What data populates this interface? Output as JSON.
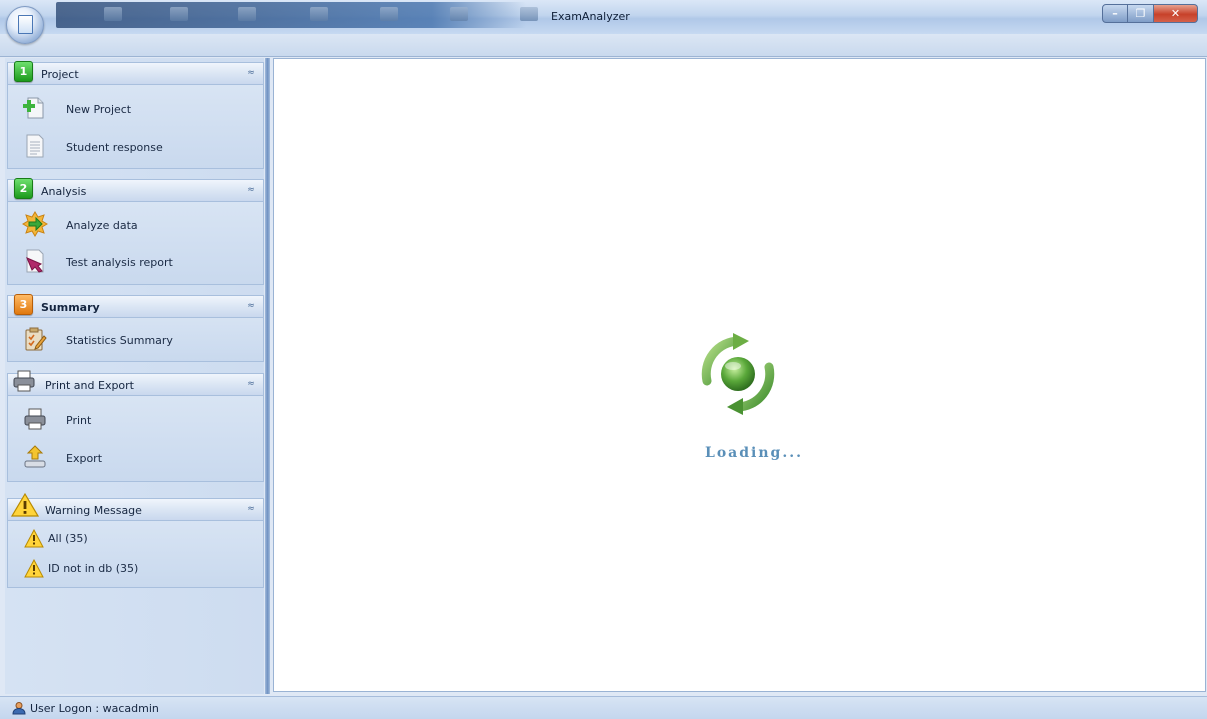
{
  "window": {
    "title": "ExamAnalyzer",
    "controls": {
      "minimize": "–",
      "maximize": "❐",
      "close": "✕"
    }
  },
  "nav": {
    "groups": [
      {
        "number": "1",
        "badge_color": "#2aa52a",
        "title": "Project",
        "items": [
          {
            "label": "New Project",
            "icon": "new-project-icon"
          },
          {
            "label": "Student response",
            "icon": "document-icon"
          }
        ]
      },
      {
        "number": "2",
        "badge_color": "#2aa52a",
        "title": "Analysis",
        "items": [
          {
            "label": "Analyze data",
            "icon": "analyze-icon"
          },
          {
            "label": "Test analysis report",
            "icon": "report-icon"
          }
        ]
      },
      {
        "number": "3",
        "badge_color": "#e8841c",
        "title": "Summary",
        "items": [
          {
            "label": "Statistics Summary",
            "icon": "clipboard-icon"
          }
        ]
      },
      {
        "title": "Print and Export",
        "items": [
          {
            "label": "Print",
            "icon": "printer-icon"
          },
          {
            "label": "Export",
            "icon": "export-icon"
          }
        ]
      },
      {
        "title": "Warning Message",
        "items": [
          {
            "label": "All (35)",
            "icon": "warning-icon"
          },
          {
            "label": "ID not in db (35)",
            "icon": "warning-icon"
          }
        ]
      }
    ],
    "collapse_glyph": "≈"
  },
  "main": {
    "loading_text": "Loading...",
    "accent_color": "#5a8fb8"
  },
  "status": {
    "text": "User Logon : wacadmin"
  }
}
